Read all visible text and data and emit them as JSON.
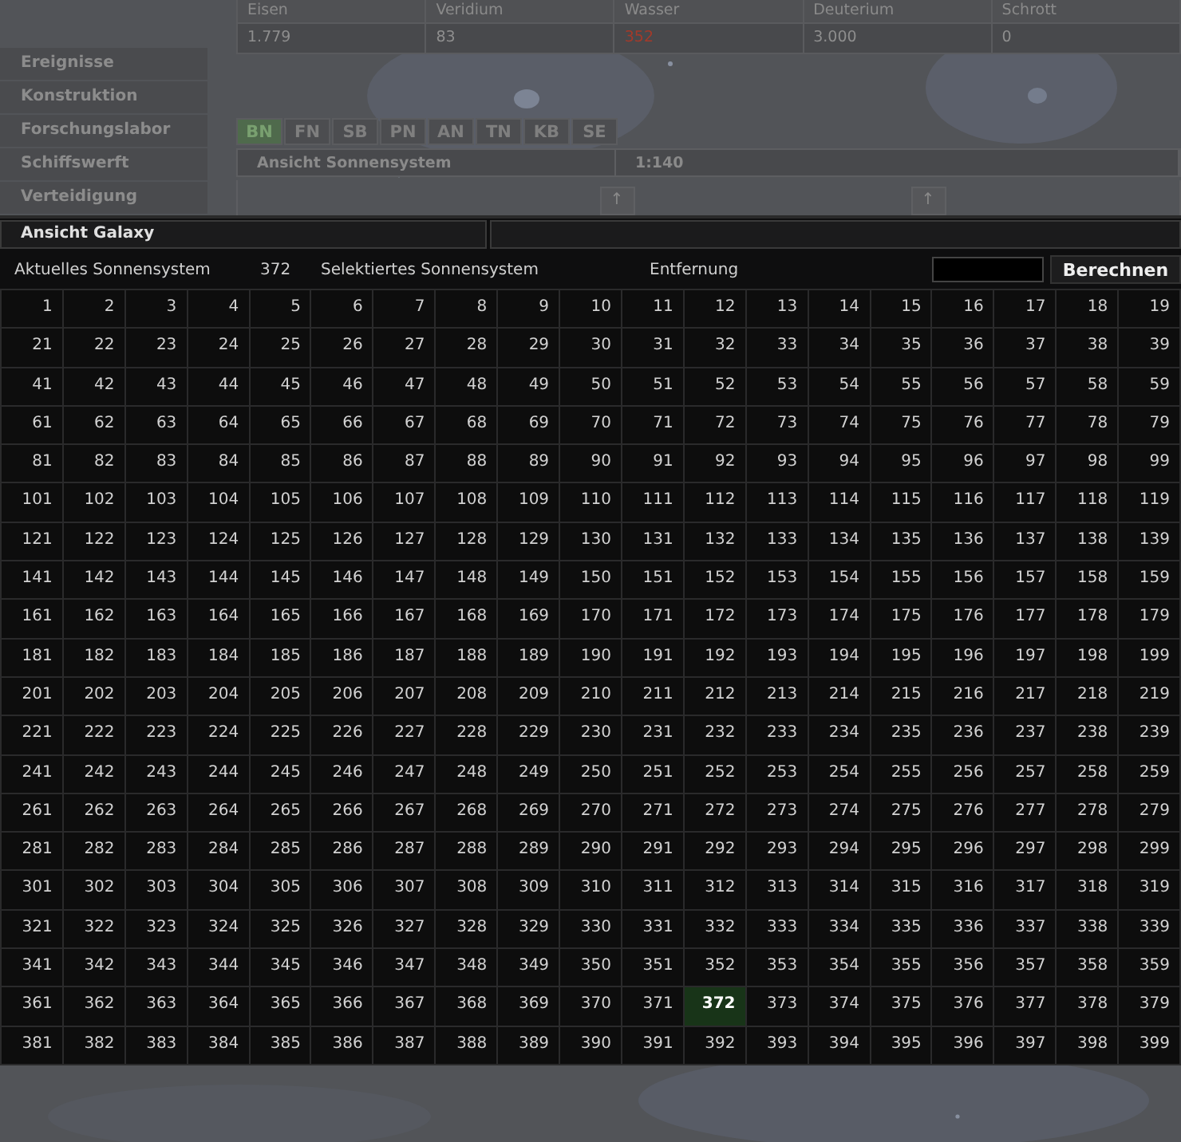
{
  "resources": {
    "columns": [
      "Eisen",
      "Veridium",
      "Wasser",
      "Deuterium",
      "Schrott"
    ],
    "values": [
      {
        "text": "1.779",
        "warning": false
      },
      {
        "text": "83",
        "warning": false
      },
      {
        "text": "352",
        "warning": true
      },
      {
        "text": "3.000",
        "warning": false
      },
      {
        "text": "0",
        "warning": false
      }
    ]
  },
  "sidebar": {
    "items": [
      "Ereignisse",
      "Konstruktion",
      "Forschungslabor",
      "Schiffswerft",
      "Verteidigung"
    ]
  },
  "tabs": [
    {
      "label": "BN",
      "selected": true
    },
    {
      "label": "FN",
      "selected": false
    },
    {
      "label": "SB",
      "selected": false
    },
    {
      "label": "PN",
      "selected": false
    },
    {
      "label": "AN",
      "selected": false
    },
    {
      "label": "TN",
      "selected": false
    },
    {
      "label": "KB",
      "selected": false
    },
    {
      "label": "SE",
      "selected": false
    }
  ],
  "system_view": {
    "title": "Ansicht Sonnensystem",
    "scale": "1:140",
    "arrows": [
      "↑",
      "↑"
    ]
  },
  "galaxy": {
    "title": "Ansicht Galaxy",
    "current_label": "Aktuelles Sonnensystem",
    "current_value": "372",
    "selected_label": "Selektiertes Sonnensystem",
    "distance_label": "Entfernung",
    "button": "Berechnen",
    "rows": [
      [
        {
          "label": "1",
          "selected": false
        },
        {
          "label": "2",
          "selected": false
        },
        {
          "label": "3",
          "selected": false
        },
        {
          "label": "4",
          "selected": false
        },
        {
          "label": "5",
          "selected": false
        },
        {
          "label": "6",
          "selected": false
        },
        {
          "label": "7",
          "selected": false
        },
        {
          "label": "8",
          "selected": false
        },
        {
          "label": "9",
          "selected": false
        },
        {
          "label": "10",
          "selected": false
        },
        {
          "label": "11",
          "selected": false
        },
        {
          "label": "12",
          "selected": false
        },
        {
          "label": "13",
          "selected": false
        },
        {
          "label": "14",
          "selected": false
        },
        {
          "label": "15",
          "selected": false
        },
        {
          "label": "16",
          "selected": false
        },
        {
          "label": "17",
          "selected": false
        },
        {
          "label": "18",
          "selected": false
        },
        {
          "label": "19",
          "selected": false
        }
      ],
      [
        {
          "label": "21",
          "selected": false
        },
        {
          "label": "22",
          "selected": false
        },
        {
          "label": "23",
          "selected": false
        },
        {
          "label": "24",
          "selected": false
        },
        {
          "label": "25",
          "selected": false
        },
        {
          "label": "26",
          "selected": false
        },
        {
          "label": "27",
          "selected": false
        },
        {
          "label": "28",
          "selected": false
        },
        {
          "label": "29",
          "selected": false
        },
        {
          "label": "30",
          "selected": false
        },
        {
          "label": "31",
          "selected": false
        },
        {
          "label": "32",
          "selected": false
        },
        {
          "label": "33",
          "selected": false
        },
        {
          "label": "34",
          "selected": false
        },
        {
          "label": "35",
          "selected": false
        },
        {
          "label": "36",
          "selected": false
        },
        {
          "label": "37",
          "selected": false
        },
        {
          "label": "38",
          "selected": false
        },
        {
          "label": "39",
          "selected": false
        }
      ],
      [
        {
          "label": "41",
          "selected": false
        },
        {
          "label": "42",
          "selected": false
        },
        {
          "label": "43",
          "selected": false
        },
        {
          "label": "44",
          "selected": false
        },
        {
          "label": "45",
          "selected": false
        },
        {
          "label": "46",
          "selected": false
        },
        {
          "label": "47",
          "selected": false
        },
        {
          "label": "48",
          "selected": false
        },
        {
          "label": "49",
          "selected": false
        },
        {
          "label": "50",
          "selected": false
        },
        {
          "label": "51",
          "selected": false
        },
        {
          "label": "52",
          "selected": false
        },
        {
          "label": "53",
          "selected": false
        },
        {
          "label": "54",
          "selected": false
        },
        {
          "label": "55",
          "selected": false
        },
        {
          "label": "56",
          "selected": false
        },
        {
          "label": "57",
          "selected": false
        },
        {
          "label": "58",
          "selected": false
        },
        {
          "label": "59",
          "selected": false
        }
      ],
      [
        {
          "label": "61",
          "selected": false
        },
        {
          "label": "62",
          "selected": false
        },
        {
          "label": "63",
          "selected": false
        },
        {
          "label": "64",
          "selected": false
        },
        {
          "label": "65",
          "selected": false
        },
        {
          "label": "66",
          "selected": false
        },
        {
          "label": "67",
          "selected": false
        },
        {
          "label": "68",
          "selected": false
        },
        {
          "label": "69",
          "selected": false
        },
        {
          "label": "70",
          "selected": false
        },
        {
          "label": "71",
          "selected": false
        },
        {
          "label": "72",
          "selected": false
        },
        {
          "label": "73",
          "selected": false
        },
        {
          "label": "74",
          "selected": false
        },
        {
          "label": "75",
          "selected": false
        },
        {
          "label": "76",
          "selected": false
        },
        {
          "label": "77",
          "selected": false
        },
        {
          "label": "78",
          "selected": false
        },
        {
          "label": "79",
          "selected": false
        }
      ],
      [
        {
          "label": "81",
          "selected": false
        },
        {
          "label": "82",
          "selected": false
        },
        {
          "label": "83",
          "selected": false
        },
        {
          "label": "84",
          "selected": false
        },
        {
          "label": "85",
          "selected": false
        },
        {
          "label": "86",
          "selected": false
        },
        {
          "label": "87",
          "selected": false
        },
        {
          "label": "88",
          "selected": false
        },
        {
          "label": "89",
          "selected": false
        },
        {
          "label": "90",
          "selected": false
        },
        {
          "label": "91",
          "selected": false
        },
        {
          "label": "92",
          "selected": false
        },
        {
          "label": "93",
          "selected": false
        },
        {
          "label": "94",
          "selected": false
        },
        {
          "label": "95",
          "selected": false
        },
        {
          "label": "96",
          "selected": false
        },
        {
          "label": "97",
          "selected": false
        },
        {
          "label": "98",
          "selected": false
        },
        {
          "label": "99",
          "selected": false
        }
      ],
      [
        {
          "label": "101",
          "selected": false
        },
        {
          "label": "102",
          "selected": false
        },
        {
          "label": "103",
          "selected": false
        },
        {
          "label": "104",
          "selected": false
        },
        {
          "label": "105",
          "selected": false
        },
        {
          "label": "106",
          "selected": false
        },
        {
          "label": "107",
          "selected": false
        },
        {
          "label": "108",
          "selected": false
        },
        {
          "label": "109",
          "selected": false
        },
        {
          "label": "110",
          "selected": false
        },
        {
          "label": "111",
          "selected": false
        },
        {
          "label": "112",
          "selected": false
        },
        {
          "label": "113",
          "selected": false
        },
        {
          "label": "114",
          "selected": false
        },
        {
          "label": "115",
          "selected": false
        },
        {
          "label": "116",
          "selected": false
        },
        {
          "label": "117",
          "selected": false
        },
        {
          "label": "118",
          "selected": false
        },
        {
          "label": "119",
          "selected": false
        }
      ],
      [
        {
          "label": "121",
          "selected": false
        },
        {
          "label": "122",
          "selected": false
        },
        {
          "label": "123",
          "selected": false
        },
        {
          "label": "124",
          "selected": false
        },
        {
          "label": "125",
          "selected": false
        },
        {
          "label": "126",
          "selected": false
        },
        {
          "label": "127",
          "selected": false
        },
        {
          "label": "128",
          "selected": false
        },
        {
          "label": "129",
          "selected": false
        },
        {
          "label": "130",
          "selected": false
        },
        {
          "label": "131",
          "selected": false
        },
        {
          "label": "132",
          "selected": false
        },
        {
          "label": "133",
          "selected": false
        },
        {
          "label": "134",
          "selected": false
        },
        {
          "label": "135",
          "selected": false
        },
        {
          "label": "136",
          "selected": false
        },
        {
          "label": "137",
          "selected": false
        },
        {
          "label": "138",
          "selected": false
        },
        {
          "label": "139",
          "selected": false
        }
      ],
      [
        {
          "label": "141",
          "selected": false
        },
        {
          "label": "142",
          "selected": false
        },
        {
          "label": "143",
          "selected": false
        },
        {
          "label": "144",
          "selected": false
        },
        {
          "label": "145",
          "selected": false
        },
        {
          "label": "146",
          "selected": false
        },
        {
          "label": "147",
          "selected": false
        },
        {
          "label": "148",
          "selected": false
        },
        {
          "label": "149",
          "selected": false
        },
        {
          "label": "150",
          "selected": false
        },
        {
          "label": "151",
          "selected": false
        },
        {
          "label": "152",
          "selected": false
        },
        {
          "label": "153",
          "selected": false
        },
        {
          "label": "154",
          "selected": false
        },
        {
          "label": "155",
          "selected": false
        },
        {
          "label": "156",
          "selected": false
        },
        {
          "label": "157",
          "selected": false
        },
        {
          "label": "158",
          "selected": false
        },
        {
          "label": "159",
          "selected": false
        }
      ],
      [
        {
          "label": "161",
          "selected": false
        },
        {
          "label": "162",
          "selected": false
        },
        {
          "label": "163",
          "selected": false
        },
        {
          "label": "164",
          "selected": false
        },
        {
          "label": "165",
          "selected": false
        },
        {
          "label": "166",
          "selected": false
        },
        {
          "label": "167",
          "selected": false
        },
        {
          "label": "168",
          "selected": false
        },
        {
          "label": "169",
          "selected": false
        },
        {
          "label": "170",
          "selected": false
        },
        {
          "label": "171",
          "selected": false
        },
        {
          "label": "172",
          "selected": false
        },
        {
          "label": "173",
          "selected": false
        },
        {
          "label": "174",
          "selected": false
        },
        {
          "label": "175",
          "selected": false
        },
        {
          "label": "176",
          "selected": false
        },
        {
          "label": "177",
          "selected": false
        },
        {
          "label": "178",
          "selected": false
        },
        {
          "label": "179",
          "selected": false
        }
      ],
      [
        {
          "label": "181",
          "selected": false
        },
        {
          "label": "182",
          "selected": false
        },
        {
          "label": "183",
          "selected": false
        },
        {
          "label": "184",
          "selected": false
        },
        {
          "label": "185",
          "selected": false
        },
        {
          "label": "186",
          "selected": false
        },
        {
          "label": "187",
          "selected": false
        },
        {
          "label": "188",
          "selected": false
        },
        {
          "label": "189",
          "selected": false
        },
        {
          "label": "190",
          "selected": false
        },
        {
          "label": "191",
          "selected": false
        },
        {
          "label": "192",
          "selected": false
        },
        {
          "label": "193",
          "selected": false
        },
        {
          "label": "194",
          "selected": false
        },
        {
          "label": "195",
          "selected": false
        },
        {
          "label": "196",
          "selected": false
        },
        {
          "label": "197",
          "selected": false
        },
        {
          "label": "198",
          "selected": false
        },
        {
          "label": "199",
          "selected": false
        }
      ],
      [
        {
          "label": "201",
          "selected": false
        },
        {
          "label": "202",
          "selected": false
        },
        {
          "label": "203",
          "selected": false
        },
        {
          "label": "204",
          "selected": false
        },
        {
          "label": "205",
          "selected": false
        },
        {
          "label": "206",
          "selected": false
        },
        {
          "label": "207",
          "selected": false
        },
        {
          "label": "208",
          "selected": false
        },
        {
          "label": "209",
          "selected": false
        },
        {
          "label": "210",
          "selected": false
        },
        {
          "label": "211",
          "selected": false
        },
        {
          "label": "212",
          "selected": false
        },
        {
          "label": "213",
          "selected": false
        },
        {
          "label": "214",
          "selected": false
        },
        {
          "label": "215",
          "selected": false
        },
        {
          "label": "216",
          "selected": false
        },
        {
          "label": "217",
          "selected": false
        },
        {
          "label": "218",
          "selected": false
        },
        {
          "label": "219",
          "selected": false
        }
      ],
      [
        {
          "label": "221",
          "selected": false
        },
        {
          "label": "222",
          "selected": false
        },
        {
          "label": "223",
          "selected": false
        },
        {
          "label": "224",
          "selected": false
        },
        {
          "label": "225",
          "selected": false
        },
        {
          "label": "226",
          "selected": false
        },
        {
          "label": "227",
          "selected": false
        },
        {
          "label": "228",
          "selected": false
        },
        {
          "label": "229",
          "selected": false
        },
        {
          "label": "230",
          "selected": false
        },
        {
          "label": "231",
          "selected": false
        },
        {
          "label": "232",
          "selected": false
        },
        {
          "label": "233",
          "selected": false
        },
        {
          "label": "234",
          "selected": false
        },
        {
          "label": "235",
          "selected": false
        },
        {
          "label": "236",
          "selected": false
        },
        {
          "label": "237",
          "selected": false
        },
        {
          "label": "238",
          "selected": false
        },
        {
          "label": "239",
          "selected": false
        }
      ],
      [
        {
          "label": "241",
          "selected": false
        },
        {
          "label": "242",
          "selected": false
        },
        {
          "label": "243",
          "selected": false
        },
        {
          "label": "244",
          "selected": false
        },
        {
          "label": "245",
          "selected": false
        },
        {
          "label": "246",
          "selected": false
        },
        {
          "label": "247",
          "selected": false
        },
        {
          "label": "248",
          "selected": false
        },
        {
          "label": "249",
          "selected": false
        },
        {
          "label": "250",
          "selected": false
        },
        {
          "label": "251",
          "selected": false
        },
        {
          "label": "252",
          "selected": false
        },
        {
          "label": "253",
          "selected": false
        },
        {
          "label": "254",
          "selected": false
        },
        {
          "label": "255",
          "selected": false
        },
        {
          "label": "256",
          "selected": false
        },
        {
          "label": "257",
          "selected": false
        },
        {
          "label": "258",
          "selected": false
        },
        {
          "label": "259",
          "selected": false
        }
      ],
      [
        {
          "label": "261",
          "selected": false
        },
        {
          "label": "262",
          "selected": false
        },
        {
          "label": "263",
          "selected": false
        },
        {
          "label": "264",
          "selected": false
        },
        {
          "label": "265",
          "selected": false
        },
        {
          "label": "266",
          "selected": false
        },
        {
          "label": "267",
          "selected": false
        },
        {
          "label": "268",
          "selected": false
        },
        {
          "label": "269",
          "selected": false
        },
        {
          "label": "270",
          "selected": false
        },
        {
          "label": "271",
          "selected": false
        },
        {
          "label": "272",
          "selected": false
        },
        {
          "label": "273",
          "selected": false
        },
        {
          "label": "274",
          "selected": false
        },
        {
          "label": "275",
          "selected": false
        },
        {
          "label": "276",
          "selected": false
        },
        {
          "label": "277",
          "selected": false
        },
        {
          "label": "278",
          "selected": false
        },
        {
          "label": "279",
          "selected": false
        }
      ],
      [
        {
          "label": "281",
          "selected": false
        },
        {
          "label": "282",
          "selected": false
        },
        {
          "label": "283",
          "selected": false
        },
        {
          "label": "284",
          "selected": false
        },
        {
          "label": "285",
          "selected": false
        },
        {
          "label": "286",
          "selected": false
        },
        {
          "label": "287",
          "selected": false
        },
        {
          "label": "288",
          "selected": false
        },
        {
          "label": "289",
          "selected": false
        },
        {
          "label": "290",
          "selected": false
        },
        {
          "label": "291",
          "selected": false
        },
        {
          "label": "292",
          "selected": false
        },
        {
          "label": "293",
          "selected": false
        },
        {
          "label": "294",
          "selected": false
        },
        {
          "label": "295",
          "selected": false
        },
        {
          "label": "296",
          "selected": false
        },
        {
          "label": "297",
          "selected": false
        },
        {
          "label": "298",
          "selected": false
        },
        {
          "label": "299",
          "selected": false
        }
      ],
      [
        {
          "label": "301",
          "selected": false
        },
        {
          "label": "302",
          "selected": false
        },
        {
          "label": "303",
          "selected": false
        },
        {
          "label": "304",
          "selected": false
        },
        {
          "label": "305",
          "selected": false
        },
        {
          "label": "306",
          "selected": false
        },
        {
          "label": "307",
          "selected": false
        },
        {
          "label": "308",
          "selected": false
        },
        {
          "label": "309",
          "selected": false
        },
        {
          "label": "310",
          "selected": false
        },
        {
          "label": "311",
          "selected": false
        },
        {
          "label": "312",
          "selected": false
        },
        {
          "label": "313",
          "selected": false
        },
        {
          "label": "314",
          "selected": false
        },
        {
          "label": "315",
          "selected": false
        },
        {
          "label": "316",
          "selected": false
        },
        {
          "label": "317",
          "selected": false
        },
        {
          "label": "318",
          "selected": false
        },
        {
          "label": "319",
          "selected": false
        }
      ],
      [
        {
          "label": "321",
          "selected": false
        },
        {
          "label": "322",
          "selected": false
        },
        {
          "label": "323",
          "selected": false
        },
        {
          "label": "324",
          "selected": false
        },
        {
          "label": "325",
          "selected": false
        },
        {
          "label": "326",
          "selected": false
        },
        {
          "label": "327",
          "selected": false
        },
        {
          "label": "328",
          "selected": false
        },
        {
          "label": "329",
          "selected": false
        },
        {
          "label": "330",
          "selected": false
        },
        {
          "label": "331",
          "selected": false
        },
        {
          "label": "332",
          "selected": false
        },
        {
          "label": "333",
          "selected": false
        },
        {
          "label": "334",
          "selected": false
        },
        {
          "label": "335",
          "selected": false
        },
        {
          "label": "336",
          "selected": false
        },
        {
          "label": "337",
          "selected": false
        },
        {
          "label": "338",
          "selected": false
        },
        {
          "label": "339",
          "selected": false
        }
      ],
      [
        {
          "label": "341",
          "selected": false
        },
        {
          "label": "342",
          "selected": false
        },
        {
          "label": "343",
          "selected": false
        },
        {
          "label": "344",
          "selected": false
        },
        {
          "label": "345",
          "selected": false
        },
        {
          "label": "346",
          "selected": false
        },
        {
          "label": "347",
          "selected": false
        },
        {
          "label": "348",
          "selected": false
        },
        {
          "label": "349",
          "selected": false
        },
        {
          "label": "350",
          "selected": false
        },
        {
          "label": "351",
          "selected": false
        },
        {
          "label": "352",
          "selected": false
        },
        {
          "label": "353",
          "selected": false
        },
        {
          "label": "354",
          "selected": false
        },
        {
          "label": "355",
          "selected": false
        },
        {
          "label": "356",
          "selected": false
        },
        {
          "label": "357",
          "selected": false
        },
        {
          "label": "358",
          "selected": false
        },
        {
          "label": "359",
          "selected": false
        }
      ],
      [
        {
          "label": "361",
          "selected": false
        },
        {
          "label": "362",
          "selected": false
        },
        {
          "label": "363",
          "selected": false
        },
        {
          "label": "364",
          "selected": false
        },
        {
          "label": "365",
          "selected": false
        },
        {
          "label": "366",
          "selected": false
        },
        {
          "label": "367",
          "selected": false
        },
        {
          "label": "368",
          "selected": false
        },
        {
          "label": "369",
          "selected": false
        },
        {
          "label": "370",
          "selected": false
        },
        {
          "label": "371",
          "selected": false
        },
        {
          "label": "372",
          "selected": true
        },
        {
          "label": "373",
          "selected": false
        },
        {
          "label": "374",
          "selected": false
        },
        {
          "label": "375",
          "selected": false
        },
        {
          "label": "376",
          "selected": false
        },
        {
          "label": "377",
          "selected": false
        },
        {
          "label": "378",
          "selected": false
        },
        {
          "label": "379",
          "selected": false
        }
      ],
      [
        {
          "label": "381",
          "selected": false
        },
        {
          "label": "382",
          "selected": false
        },
        {
          "label": "383",
          "selected": false
        },
        {
          "label": "384",
          "selected": false
        },
        {
          "label": "385",
          "selected": false
        },
        {
          "label": "386",
          "selected": false
        },
        {
          "label": "387",
          "selected": false
        },
        {
          "label": "388",
          "selected": false
        },
        {
          "label": "389",
          "selected": false
        },
        {
          "label": "390",
          "selected": false
        },
        {
          "label": "391",
          "selected": false
        },
        {
          "label": "392",
          "selected": false
        },
        {
          "label": "393",
          "selected": false
        },
        {
          "label": "394",
          "selected": false
        },
        {
          "label": "395",
          "selected": false
        },
        {
          "label": "396",
          "selected": false
        },
        {
          "label": "397",
          "selected": false
        },
        {
          "label": "398",
          "selected": false
        },
        {
          "label": "399",
          "selected": false
        }
      ]
    ]
  }
}
